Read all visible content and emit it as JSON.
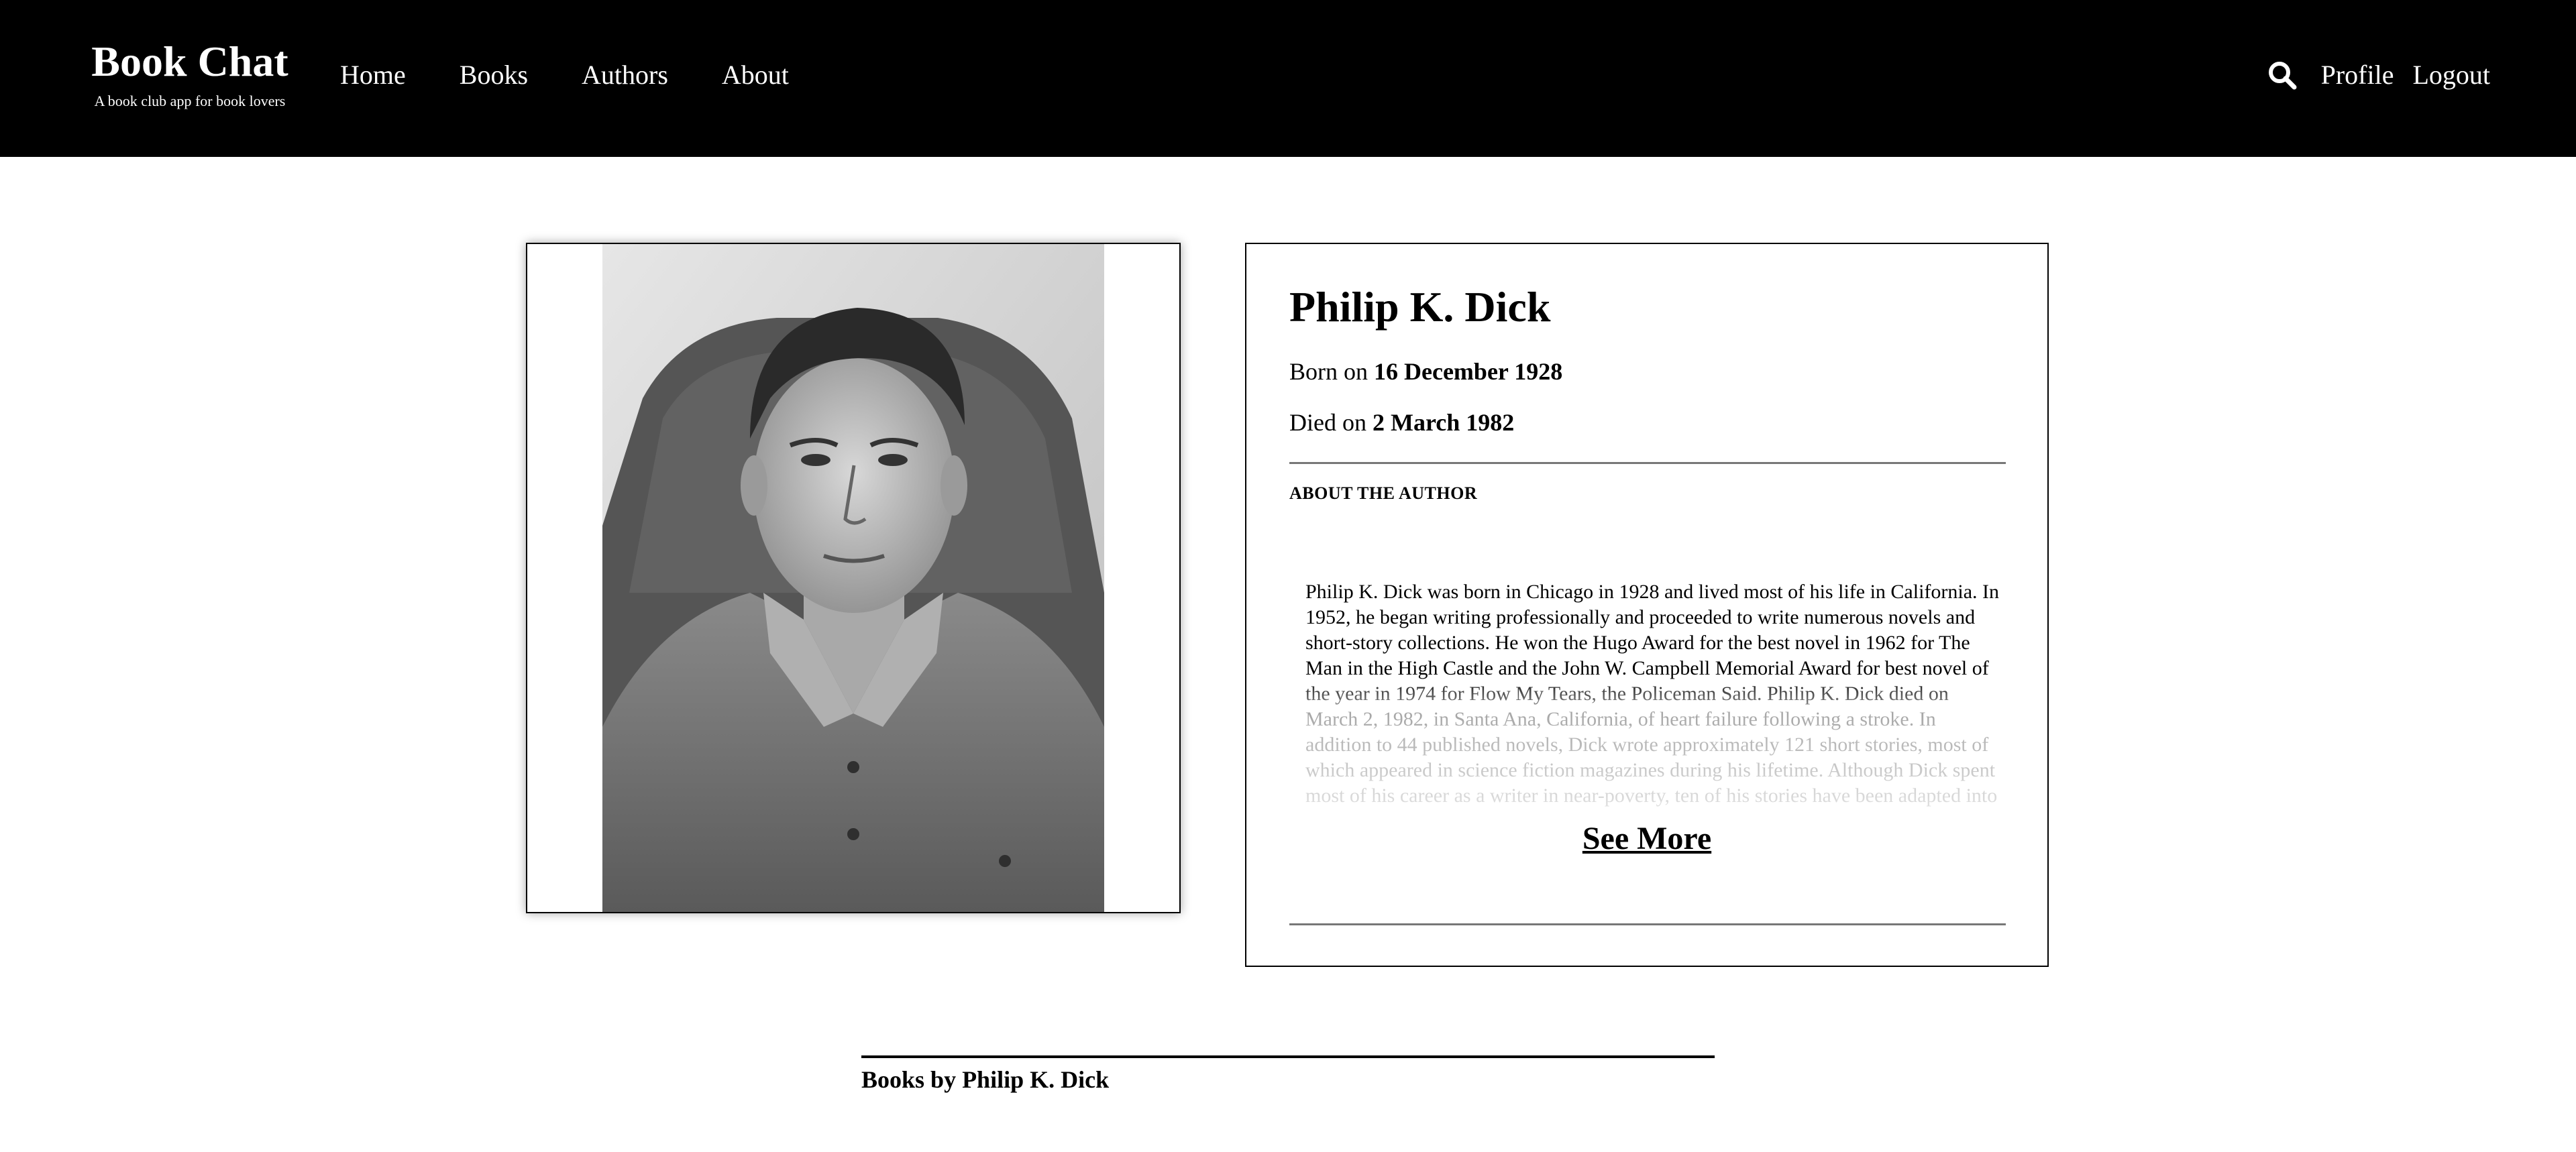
{
  "header": {
    "brand_title": "Book Chat",
    "brand_tagline": "A book club app for book lovers",
    "nav": [
      "Home",
      "Books",
      "Authors",
      "About"
    ],
    "search_icon": "search-icon",
    "profile_label": "Profile",
    "logout_label": "Logout"
  },
  "author": {
    "name": "Philip K. Dick",
    "born_prefix": "Born on",
    "born_date": "16 December 1928",
    "died_prefix": "Died on",
    "died_date": "2 March 1982",
    "about_heading": "ABOUT THE AUTHOR",
    "bio": "Philip K. Dick was born in Chicago in 1928 and lived most of his life in California. In 1952, he began writing professionally and proceeded to write numerous novels and short-story collections. He won the Hugo Award for the best novel in 1962 for The Man in the High Castle and the John W. Campbell Memorial Award for best novel of the year in 1974 for Flow My Tears, the Policeman Said. Philip K. Dick died on March 2, 1982, in Santa Ana, California, of heart failure following a stroke. In addition to 44 published novels, Dick wrote approximately 121 short stories, most of which appeared in science fiction magazines during his lifetime. Although Dick spent most of his career as a writer in near-poverty, ten of his stories have been adapted into",
    "see_more_label": "See More",
    "portrait_alt": "portrait photo"
  },
  "books_section": {
    "heading": "Books by Philip K. Dick"
  },
  "colors": {
    "header_bg": "#000000",
    "header_text": "#ffffff",
    "page_bg": "#ffffff",
    "divider": "#777777"
  }
}
